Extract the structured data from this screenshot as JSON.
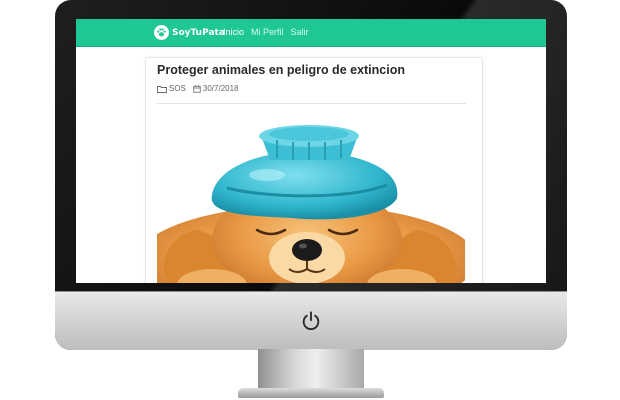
{
  "site": {
    "brand_name": "SoyTuPata",
    "nav": [
      {
        "label": "Inicio",
        "active": true
      },
      {
        "label": "Mi Perfil",
        "active": false
      },
      {
        "label": "Salir",
        "active": false
      }
    ],
    "accent_color": "#1ec794"
  },
  "post": {
    "title": "Proteger animales en peligro de extincion",
    "category": "SOS",
    "date": "30/7/2018",
    "image_subject": "puppy-with-ice-bag"
  },
  "icons": [
    "paw-icon",
    "folder-icon",
    "calendar-icon",
    "power-icon"
  ]
}
